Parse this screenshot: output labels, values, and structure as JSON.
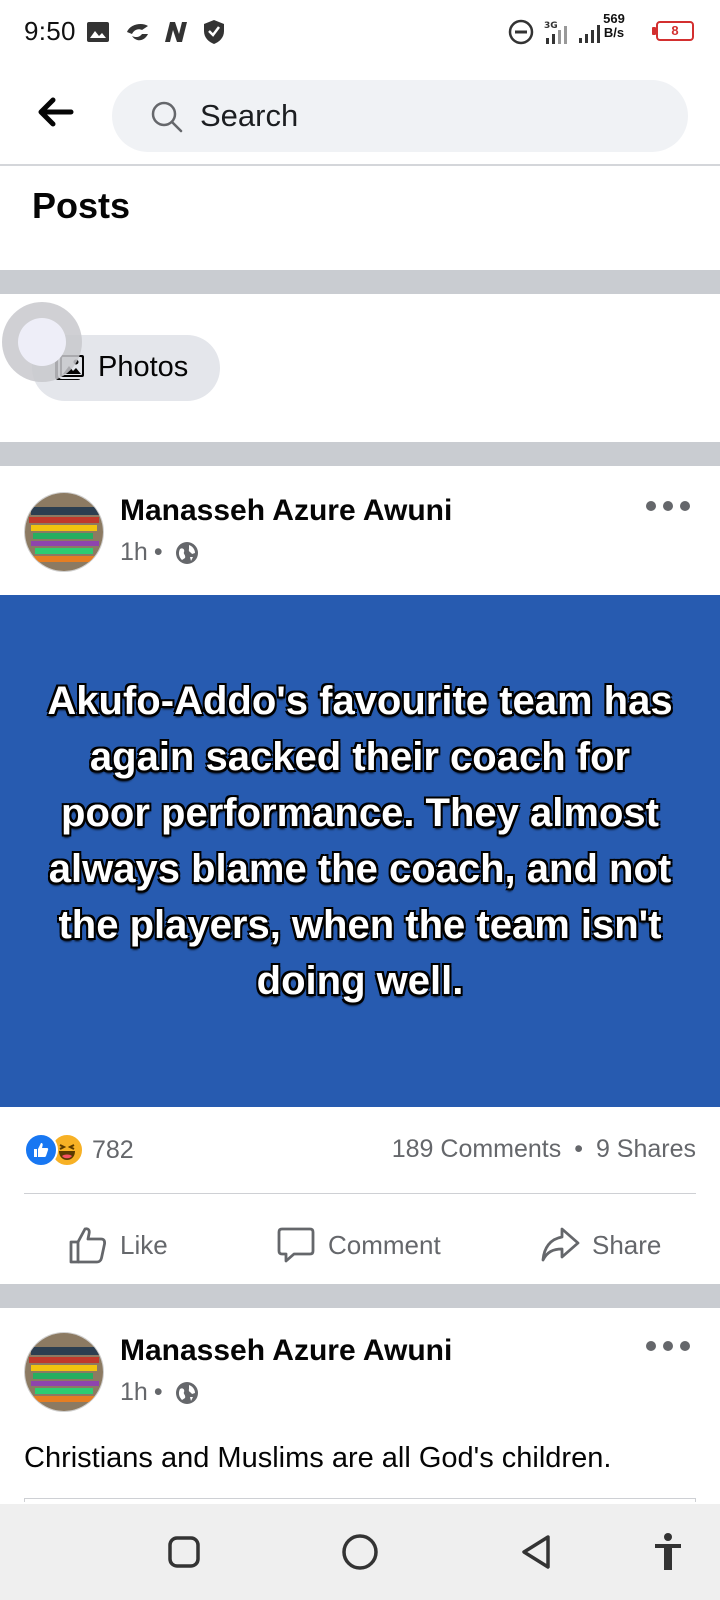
{
  "status_bar": {
    "time": "9:50",
    "network_speed_value": "569",
    "network_speed_unit": "B/s",
    "battery_level": "8"
  },
  "search": {
    "placeholder": "Search"
  },
  "section": {
    "title": "Posts"
  },
  "filters": {
    "photos_label": "Photos"
  },
  "posts": [
    {
      "author": "Manasseh Azure Awuni",
      "time": "1h",
      "separator": "•",
      "card_text": "Akufo-Addo's favourite team has again sacked  their coach for poor performance. They almost always blame the coach, and not the players, when the team isn't doing well.",
      "card_color": "#275bb0",
      "reaction_count": "782",
      "comments_label": "189 Comments",
      "shares_label": "9 Shares",
      "actions": {
        "like": "Like",
        "comment": "Comment",
        "share": "Share"
      }
    },
    {
      "author": "Manasseh Azure Awuni",
      "time": "1h",
      "separator": "•",
      "body": "Christians and Muslims are all God's children."
    }
  ],
  "icons": {
    "back": "arrow-left-icon",
    "search": "magnifier-icon",
    "photos": "photos-icon",
    "privacy": "globe-icon",
    "more": "more-horizontal-icon"
  },
  "colors": {
    "accent": "#1877f2",
    "haha": "#f7b125",
    "battery_low": "#d32f2f"
  }
}
